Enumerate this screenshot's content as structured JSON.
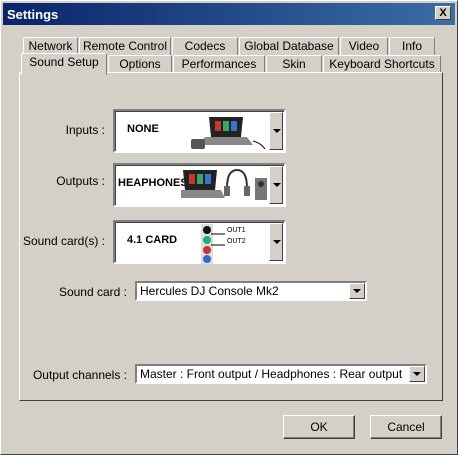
{
  "window": {
    "title": "Settings",
    "close_glyph": "X"
  },
  "tabs_row1": [
    "Network",
    "Remote Control",
    "Codecs",
    "Global Database",
    "Video",
    "Info"
  ],
  "tabs_row2": [
    "Sound Setup",
    "Options",
    "Performances",
    "Skin",
    "Keyboard Shortcuts"
  ],
  "active_tab": "Sound Setup",
  "inputs": {
    "label": "Inputs :",
    "value": "NONE",
    "icon": "laptop-icon"
  },
  "outputs": {
    "label": "Outputs :",
    "value": "HEAPHONES",
    "icon": "headphones-icon"
  },
  "sound_cards": {
    "label": "Sound card(s) :",
    "value": "4.1 CARD",
    "jack_labels": [
      "OUT1",
      "OUT2"
    ],
    "icon": "audio-jacks-icon"
  },
  "sound_card": {
    "label": "Sound card :",
    "value": "Hercules DJ Console Mk2"
  },
  "output_channels": {
    "label": "Output channels :",
    "value": "Master : Front output / Headphones : Rear output"
  },
  "buttons": {
    "ok": "OK",
    "cancel": "Cancel"
  },
  "colors": {
    "titlebar_start": "#0a246a",
    "titlebar_end": "#3a6ea5",
    "face": "#d4d0c8"
  }
}
